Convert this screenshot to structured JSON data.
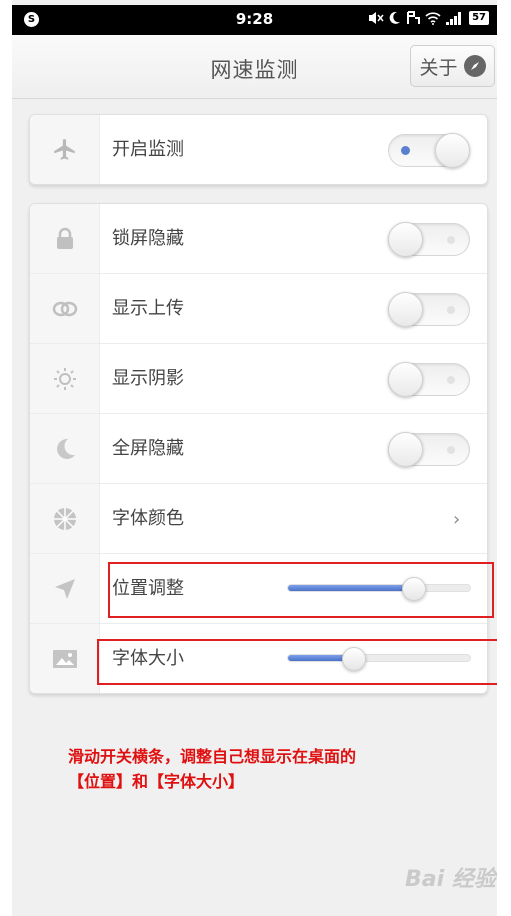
{
  "status_bar": {
    "time": "9:28",
    "battery": "57",
    "logo": "S"
  },
  "header": {
    "title": "网速监测",
    "about_label": "关于",
    "about_icon": "compass-icon"
  },
  "monitor_card": {
    "label": "开启监测",
    "icon": "airplane-icon",
    "toggle_on": true
  },
  "settings": [
    {
      "label": "锁屏隐藏",
      "icon": "lock-icon",
      "control": "toggle",
      "on": false
    },
    {
      "label": "显示上传",
      "icon": "link-icon",
      "control": "toggle",
      "on": false
    },
    {
      "label": "显示阴影",
      "icon": "sun-icon",
      "control": "toggle",
      "on": false
    },
    {
      "label": "全屏隐藏",
      "icon": "moon-icon",
      "control": "toggle",
      "on": false
    },
    {
      "label": "字体颜色",
      "icon": "palette-icon",
      "control": "chevron"
    },
    {
      "label": "位置调整",
      "icon": "location-arrow-icon",
      "control": "slider",
      "value": 0.69
    },
    {
      "label": "字体大小",
      "icon": "image-icon",
      "control": "slider",
      "value": 0.36
    }
  ],
  "annotation": {
    "line1": "滑动开关横条，调整自己想显示在桌面的",
    "line2": "【位置】和【字体大小】"
  },
  "watermark": "Bai 经验",
  "colors": {
    "accent": "#5a7fcf",
    "annotation_red": "#e01010"
  }
}
